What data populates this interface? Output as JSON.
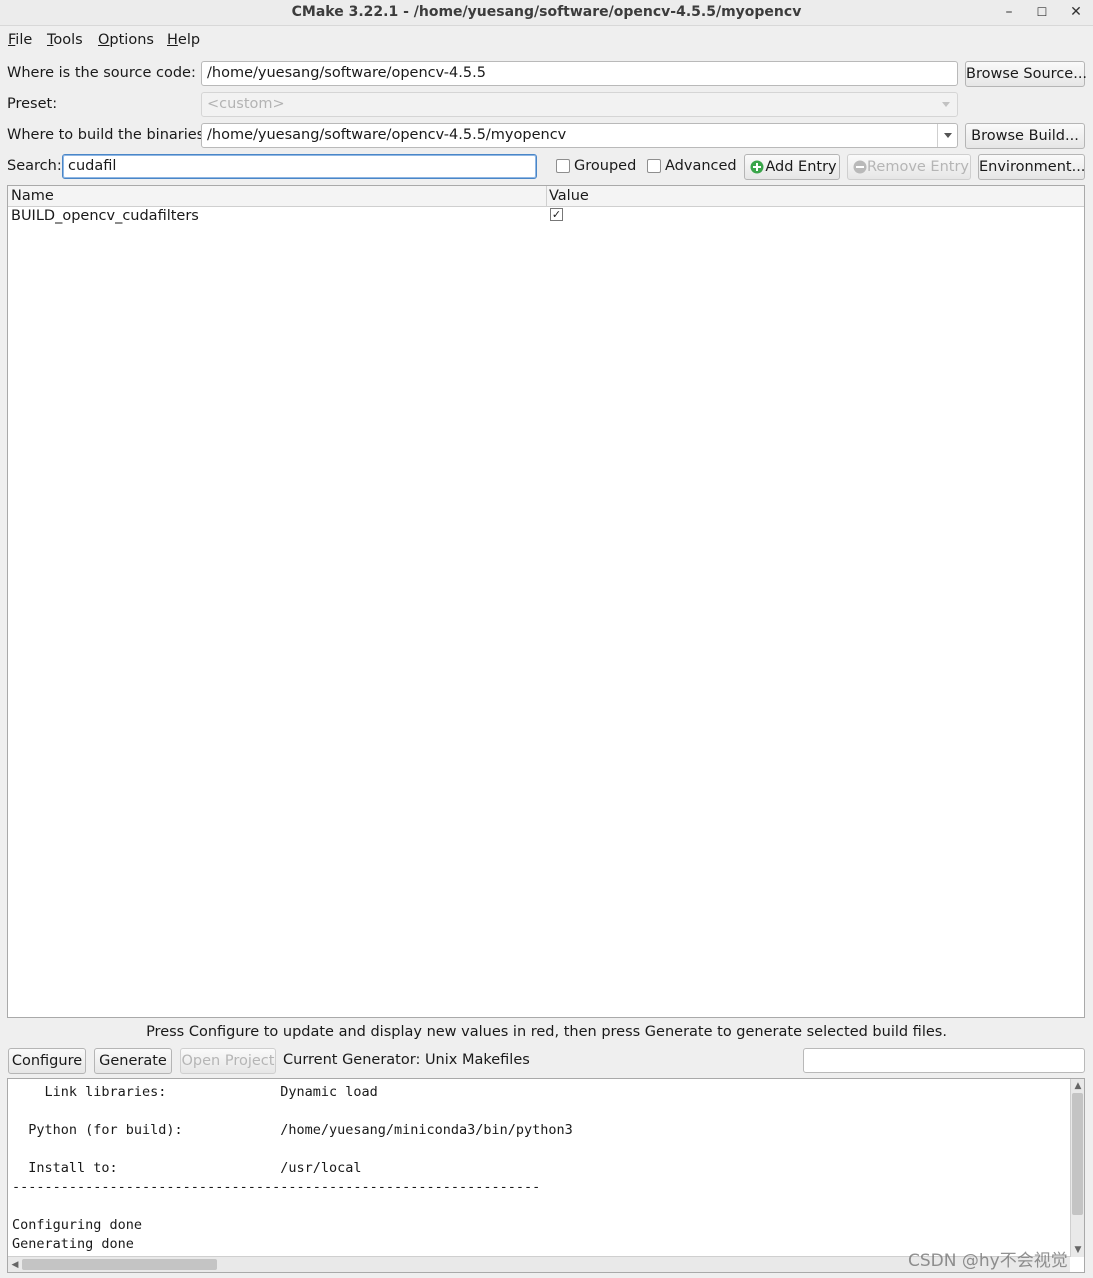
{
  "window": {
    "title": "CMake 3.22.1 - /home/yuesang/software/opencv-4.5.5/myopencv",
    "minimize": "–",
    "maximize": "☐",
    "close": "✕"
  },
  "menu": [
    {
      "underline": "F",
      "rest": "ile"
    },
    {
      "underline": "T",
      "rest": "ools"
    },
    {
      "underline": "O",
      "rest": "ptions"
    },
    {
      "underline": "H",
      "rest": "elp"
    }
  ],
  "source": {
    "label": "Where is the source code:",
    "value": "/home/yuesang/software/opencv-4.5.5",
    "browse_label": "Browse Source..."
  },
  "preset": {
    "label": "Preset:",
    "value": "<custom>"
  },
  "build": {
    "label": "Where to build the binaries:",
    "value": "/home/yuesang/software/opencv-4.5.5/myopencv",
    "browse_label": "Browse Build..."
  },
  "search": {
    "label": "Search:",
    "value": "cudafil",
    "grouped_label": "Grouped",
    "advanced_label": "Advanced",
    "add_entry_label": "Add Entry",
    "remove_entry_label": "Remove Entry",
    "environment_label": "Environment..."
  },
  "table": {
    "columns": [
      "Name",
      "Value"
    ],
    "rows": [
      {
        "name": "BUILD_opencv_cudafilters",
        "value": "✓"
      }
    ]
  },
  "hint": "Press Configure to update and display new values in red, then press Generate to generate selected build files.",
  "actions": {
    "configure_label": "Configure",
    "generate_label": "Generate",
    "open_project_label": "Open Project",
    "generator_text": "Current Generator: Unix Makefiles"
  },
  "output_text": "    Link libraries:              Dynamic load\n\n  Python (for build):            /home/yuesang/miniconda3/bin/python3\n\n  Install to:                    /usr/local\n-----------------------------------------------------------------\n\nConfiguring done\nGenerating done",
  "watermark": "CSDN @hy不会视觉"
}
